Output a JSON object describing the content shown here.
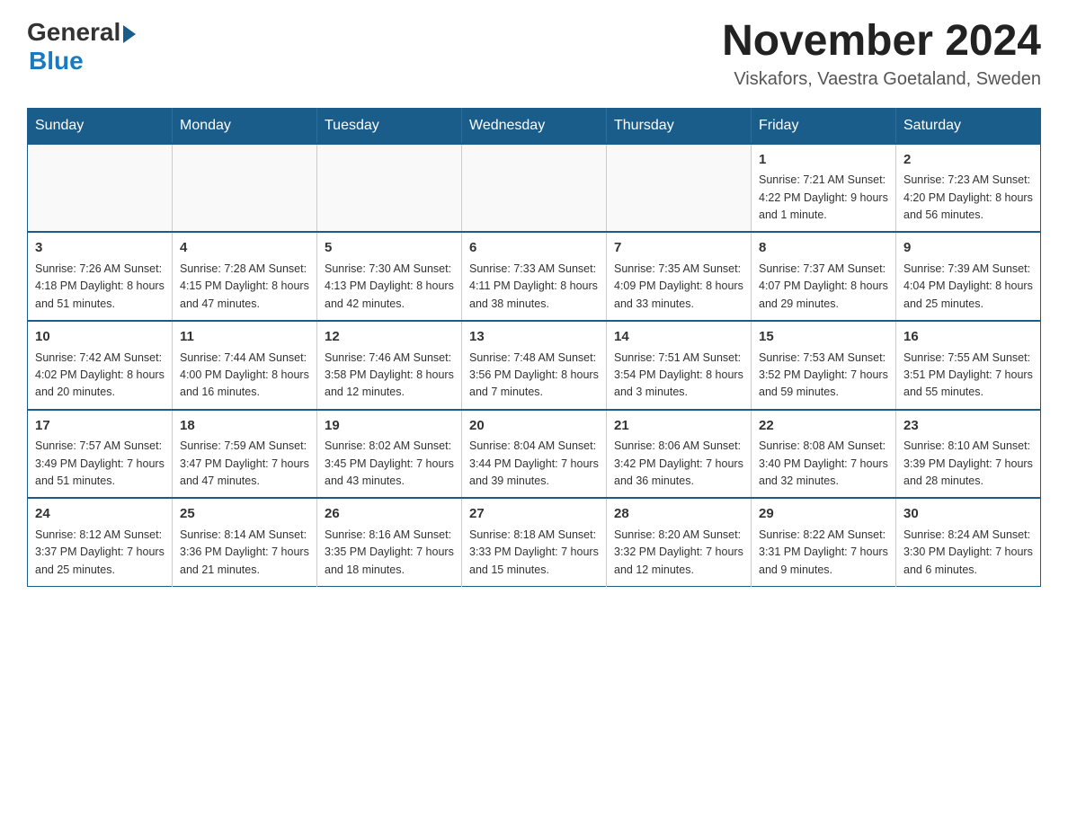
{
  "logo": {
    "general": "General",
    "blue": "Blue"
  },
  "title": {
    "month_year": "November 2024",
    "location": "Viskafors, Vaestra Goetaland, Sweden"
  },
  "days_of_week": [
    "Sunday",
    "Monday",
    "Tuesday",
    "Wednesday",
    "Thursday",
    "Friday",
    "Saturday"
  ],
  "weeks": [
    [
      {
        "day": "",
        "info": ""
      },
      {
        "day": "",
        "info": ""
      },
      {
        "day": "",
        "info": ""
      },
      {
        "day": "",
        "info": ""
      },
      {
        "day": "",
        "info": ""
      },
      {
        "day": "1",
        "info": "Sunrise: 7:21 AM\nSunset: 4:22 PM\nDaylight: 9 hours\nand 1 minute."
      },
      {
        "day": "2",
        "info": "Sunrise: 7:23 AM\nSunset: 4:20 PM\nDaylight: 8 hours\nand 56 minutes."
      }
    ],
    [
      {
        "day": "3",
        "info": "Sunrise: 7:26 AM\nSunset: 4:18 PM\nDaylight: 8 hours\nand 51 minutes."
      },
      {
        "day": "4",
        "info": "Sunrise: 7:28 AM\nSunset: 4:15 PM\nDaylight: 8 hours\nand 47 minutes."
      },
      {
        "day": "5",
        "info": "Sunrise: 7:30 AM\nSunset: 4:13 PM\nDaylight: 8 hours\nand 42 minutes."
      },
      {
        "day": "6",
        "info": "Sunrise: 7:33 AM\nSunset: 4:11 PM\nDaylight: 8 hours\nand 38 minutes."
      },
      {
        "day": "7",
        "info": "Sunrise: 7:35 AM\nSunset: 4:09 PM\nDaylight: 8 hours\nand 33 minutes."
      },
      {
        "day": "8",
        "info": "Sunrise: 7:37 AM\nSunset: 4:07 PM\nDaylight: 8 hours\nand 29 minutes."
      },
      {
        "day": "9",
        "info": "Sunrise: 7:39 AM\nSunset: 4:04 PM\nDaylight: 8 hours\nand 25 minutes."
      }
    ],
    [
      {
        "day": "10",
        "info": "Sunrise: 7:42 AM\nSunset: 4:02 PM\nDaylight: 8 hours\nand 20 minutes."
      },
      {
        "day": "11",
        "info": "Sunrise: 7:44 AM\nSunset: 4:00 PM\nDaylight: 8 hours\nand 16 minutes."
      },
      {
        "day": "12",
        "info": "Sunrise: 7:46 AM\nSunset: 3:58 PM\nDaylight: 8 hours\nand 12 minutes."
      },
      {
        "day": "13",
        "info": "Sunrise: 7:48 AM\nSunset: 3:56 PM\nDaylight: 8 hours\nand 7 minutes."
      },
      {
        "day": "14",
        "info": "Sunrise: 7:51 AM\nSunset: 3:54 PM\nDaylight: 8 hours\nand 3 minutes."
      },
      {
        "day": "15",
        "info": "Sunrise: 7:53 AM\nSunset: 3:52 PM\nDaylight: 7 hours\nand 59 minutes."
      },
      {
        "day": "16",
        "info": "Sunrise: 7:55 AM\nSunset: 3:51 PM\nDaylight: 7 hours\nand 55 minutes."
      }
    ],
    [
      {
        "day": "17",
        "info": "Sunrise: 7:57 AM\nSunset: 3:49 PM\nDaylight: 7 hours\nand 51 minutes."
      },
      {
        "day": "18",
        "info": "Sunrise: 7:59 AM\nSunset: 3:47 PM\nDaylight: 7 hours\nand 47 minutes."
      },
      {
        "day": "19",
        "info": "Sunrise: 8:02 AM\nSunset: 3:45 PM\nDaylight: 7 hours\nand 43 minutes."
      },
      {
        "day": "20",
        "info": "Sunrise: 8:04 AM\nSunset: 3:44 PM\nDaylight: 7 hours\nand 39 minutes."
      },
      {
        "day": "21",
        "info": "Sunrise: 8:06 AM\nSunset: 3:42 PM\nDaylight: 7 hours\nand 36 minutes."
      },
      {
        "day": "22",
        "info": "Sunrise: 8:08 AM\nSunset: 3:40 PM\nDaylight: 7 hours\nand 32 minutes."
      },
      {
        "day": "23",
        "info": "Sunrise: 8:10 AM\nSunset: 3:39 PM\nDaylight: 7 hours\nand 28 minutes."
      }
    ],
    [
      {
        "day": "24",
        "info": "Sunrise: 8:12 AM\nSunset: 3:37 PM\nDaylight: 7 hours\nand 25 minutes."
      },
      {
        "day": "25",
        "info": "Sunrise: 8:14 AM\nSunset: 3:36 PM\nDaylight: 7 hours\nand 21 minutes."
      },
      {
        "day": "26",
        "info": "Sunrise: 8:16 AM\nSunset: 3:35 PM\nDaylight: 7 hours\nand 18 minutes."
      },
      {
        "day": "27",
        "info": "Sunrise: 8:18 AM\nSunset: 3:33 PM\nDaylight: 7 hours\nand 15 minutes."
      },
      {
        "day": "28",
        "info": "Sunrise: 8:20 AM\nSunset: 3:32 PM\nDaylight: 7 hours\nand 12 minutes."
      },
      {
        "day": "29",
        "info": "Sunrise: 8:22 AM\nSunset: 3:31 PM\nDaylight: 7 hours\nand 9 minutes."
      },
      {
        "day": "30",
        "info": "Sunrise: 8:24 AM\nSunset: 3:30 PM\nDaylight: 7 hours\nand 6 minutes."
      }
    ]
  ]
}
